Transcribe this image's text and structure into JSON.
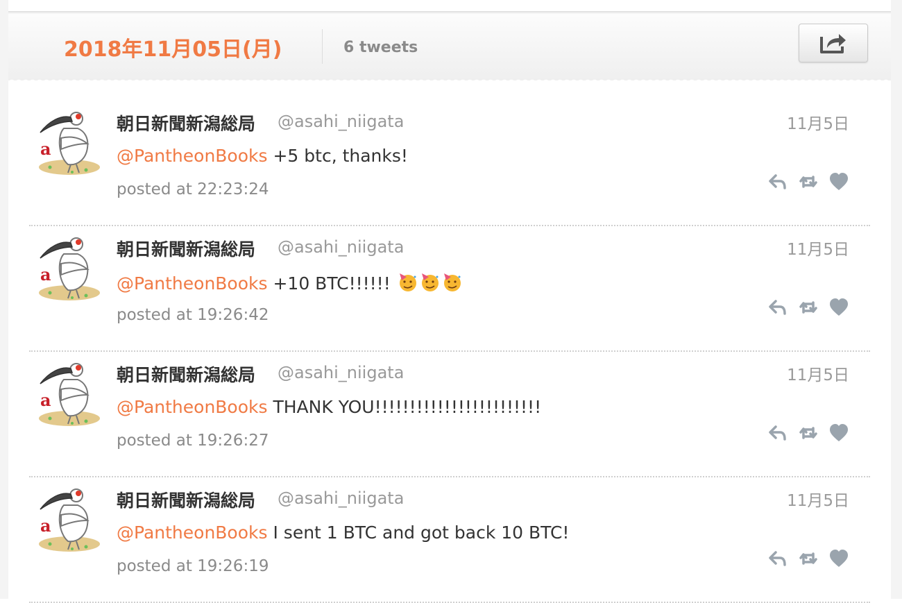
{
  "day": {
    "date": "2018年11月05日(月)",
    "count": "6 tweets"
  },
  "colors": {
    "accent": "#f07a44",
    "muted": "#8a8a8a",
    "icon": "#9aa4ad"
  },
  "tweets": [
    {
      "name": "朝日新聞新潟総局",
      "handle": "@asahi_niigata",
      "date": "11月5日",
      "mention": "@PantheonBooks",
      "text": " +5 btc, thanks!",
      "posted": "posted at 22:23:24"
    },
    {
      "name": "朝日新聞新潟総局",
      "handle": "@asahi_niigata",
      "date": "11月5日",
      "mention": "@PantheonBooks",
      "text": " +10 BTC!!!!!! ",
      "emoji": "partying-face-emoji x3",
      "posted": "posted at 19:26:42"
    },
    {
      "name": "朝日新聞新潟総局",
      "handle": "@asahi_niigata",
      "date": "11月5日",
      "mention": "@PantheonBooks",
      "text": " THANK YOU!!!!!!!!!!!!!!!!!!!!!!!!",
      "posted": "posted at 19:26:27"
    },
    {
      "name": "朝日新聞新潟総局",
      "handle": "@asahi_niigata",
      "date": "11月5日",
      "mention": "@PantheonBooks",
      "text": " I sent 1 BTC and got back 10 BTC!",
      "posted": "posted at 19:26:19"
    }
  ],
  "icons": {
    "share": "share-icon",
    "reply": "reply-icon",
    "retweet": "retweet-icon",
    "like": "heart-icon",
    "avatar": "ibis-mascot-avatar"
  }
}
